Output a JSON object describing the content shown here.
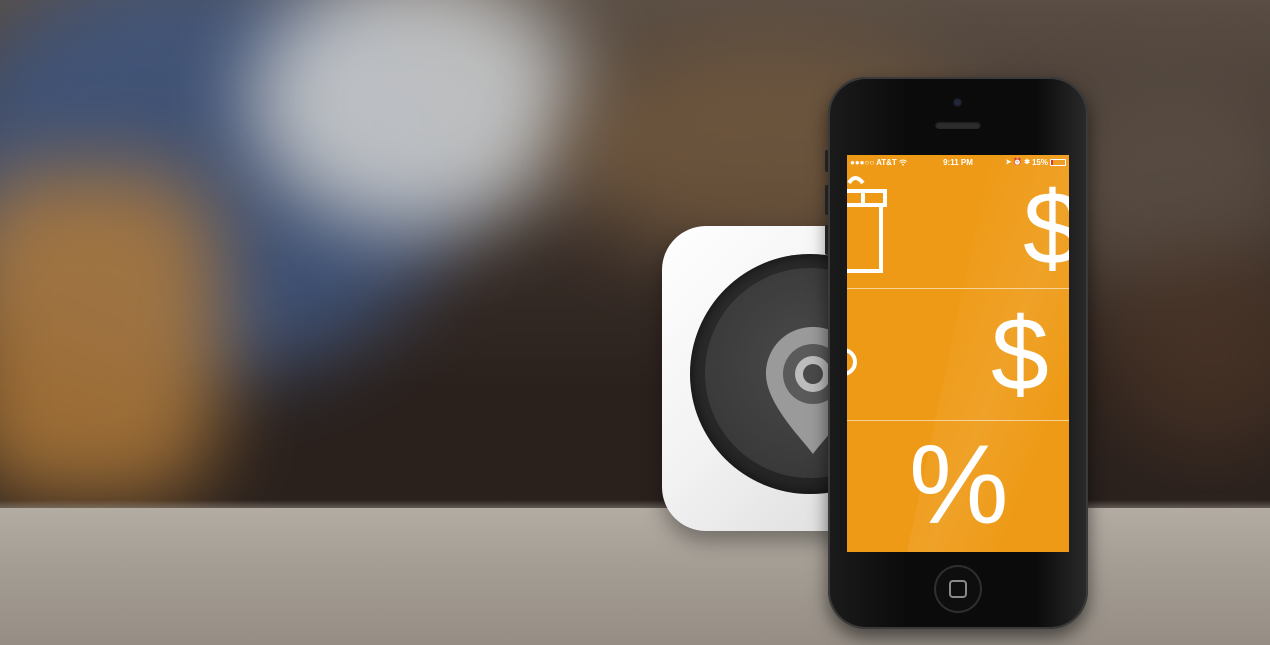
{
  "status_bar": {
    "carrier": "●●●○○ AT&T",
    "wifi_icon": "wifi-icon",
    "time": "9:11 PM",
    "battery_percent": "15%"
  },
  "screen_rows": [
    {
      "left_icon": "gift-icon",
      "right_symbol": "$"
    },
    {
      "left_icon": "pin-partial-icon",
      "right_symbol": "$"
    },
    {
      "center_symbol": "%"
    }
  ],
  "colors": {
    "screen_orange": "#ee9a16",
    "device_white": "#f1f1f1",
    "phone_black": "#0b0b0b"
  }
}
